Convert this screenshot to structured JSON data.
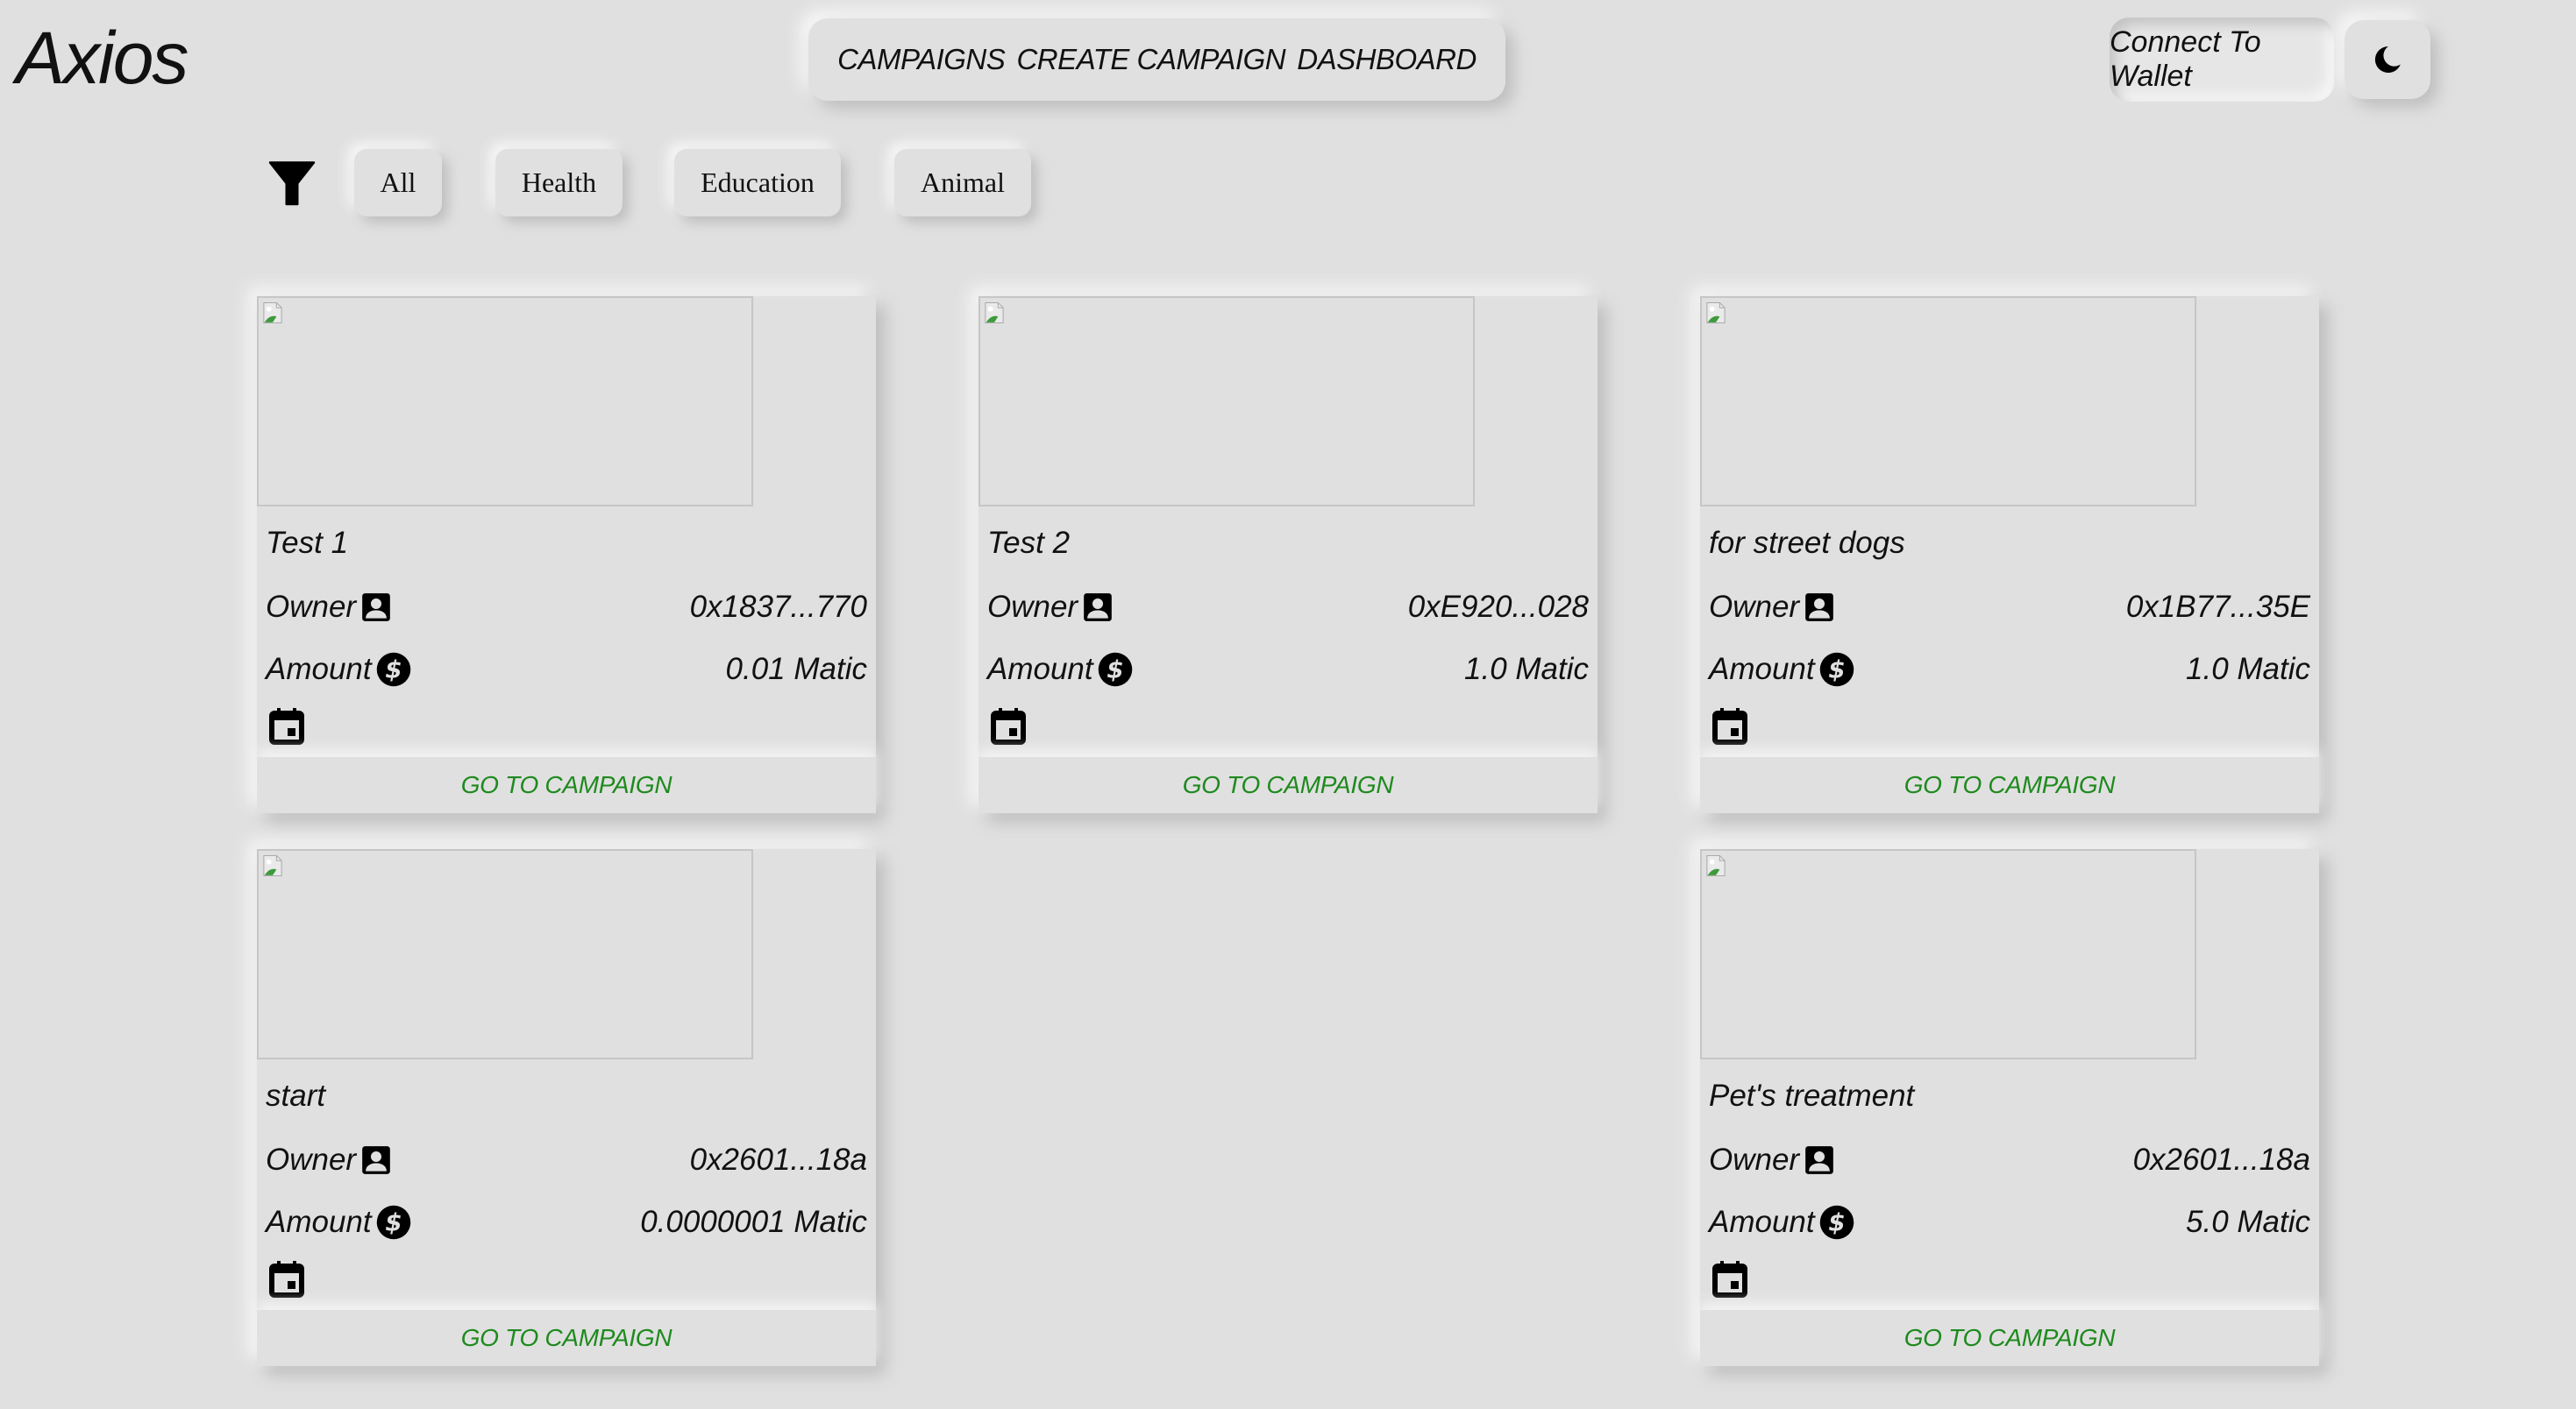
{
  "app": {
    "title": "Axios"
  },
  "nav": {
    "links": [
      "CAMPAIGNS",
      "CREATE CAMPAIGN",
      "DASHBOARD"
    ]
  },
  "header": {
    "wallet_button": "Connect To Wallet",
    "theme_toggle_icon": "moon-icon"
  },
  "filters": {
    "icon": "filter-icon",
    "chips": [
      "All",
      "Health",
      "Education",
      "Animal"
    ]
  },
  "card_labels": {
    "owner": "Owner",
    "amount": "Amount",
    "go_button": "GO TO CAMPAIGN"
  },
  "colors": {
    "background": "#e0e0e0",
    "accent_green": "#1e8a1e"
  },
  "campaigns": [
    {
      "title": "Test 1",
      "owner": "0x1837...770",
      "amount": "0.01 Matic"
    },
    {
      "title": "Test 2",
      "owner": "0xE920...028",
      "amount": "1.0 Matic"
    },
    {
      "title": "for street dogs",
      "owner": "0x1B77...35E",
      "amount": "1.0 Matic"
    },
    {
      "title": "start",
      "owner": "0x2601...18a",
      "amount": "0.0000001 Matic"
    },
    {
      "title": "Pet's treatment",
      "owner": "0x2601...18a",
      "amount": "5.0 Matic"
    }
  ]
}
